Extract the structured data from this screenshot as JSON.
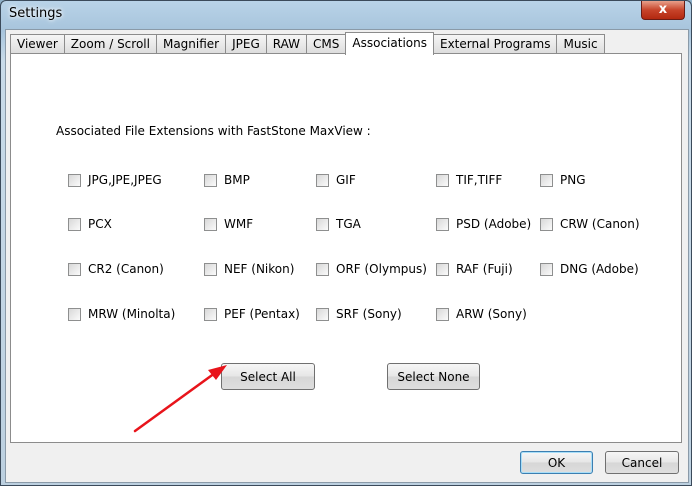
{
  "window": {
    "title": "Settings",
    "close_glyph": "x"
  },
  "tabs": [
    {
      "label": "Viewer"
    },
    {
      "label": "Zoom / Scroll"
    },
    {
      "label": "Magnifier"
    },
    {
      "label": "JPEG"
    },
    {
      "label": "RAW"
    },
    {
      "label": "CMS"
    },
    {
      "label": "Associations",
      "active": true
    },
    {
      "label": "External Programs"
    },
    {
      "label": "Music"
    }
  ],
  "associations": {
    "heading": "Associated File Extensions with FastStone MaxView :",
    "extensions": [
      {
        "label": "JPG,JPE,JPEG",
        "checked": false
      },
      {
        "label": "BMP",
        "checked": false
      },
      {
        "label": "GIF",
        "checked": false
      },
      {
        "label": "TIF,TIFF",
        "checked": false
      },
      {
        "label": "PNG",
        "checked": false
      },
      {
        "label": "PCX",
        "checked": false
      },
      {
        "label": "WMF",
        "checked": false
      },
      {
        "label": "TGA",
        "checked": false
      },
      {
        "label": "PSD (Adobe)",
        "checked": false
      },
      {
        "label": "CRW (Canon)",
        "checked": false
      },
      {
        "label": "CR2 (Canon)",
        "checked": false
      },
      {
        "label": "NEF (Nikon)",
        "checked": false
      },
      {
        "label": "ORF (Olympus)",
        "checked": false
      },
      {
        "label": "RAF (Fuji)",
        "checked": false
      },
      {
        "label": "DNG (Adobe)",
        "checked": false
      },
      {
        "label": "MRW (Minolta)",
        "checked": false
      },
      {
        "label": "PEF (Pentax)",
        "checked": false
      },
      {
        "label": "SRF (Sony)",
        "checked": false
      },
      {
        "label": "ARW (Sony)",
        "checked": false
      }
    ],
    "select_all_label": "Select All",
    "select_none_label": "Select None"
  },
  "footer": {
    "ok_label": "OK",
    "cancel_label": "Cancel"
  },
  "colors": {
    "annotation_arrow": "#e8141b"
  }
}
